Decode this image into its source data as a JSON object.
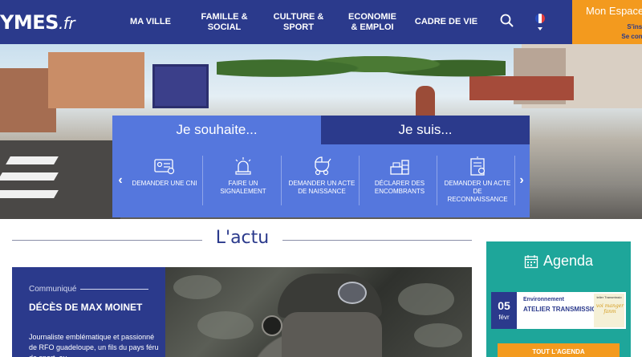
{
  "header": {
    "logo_main": "YMES",
    "logo_suffix": ".fr",
    "nav": [
      {
        "label": "MA VILLE"
      },
      {
        "label": "FAMILLE & SOCIAL"
      },
      {
        "label": "CULTURE & SPORT"
      },
      {
        "label": "ECONOMIE & EMPLOI"
      },
      {
        "label": "CADRE DE VIE"
      }
    ],
    "account_title": "Mon Espace",
    "account_signup": "S'inscri",
    "account_login": "Se conne"
  },
  "panel": {
    "tab_wish": "Je souhaite...",
    "tab_iam": "Je suis...",
    "prev": "‹",
    "next": "›",
    "services": [
      {
        "label": "DEMANDER UNE CNI",
        "icon": "id-card-icon"
      },
      {
        "label": "FAIRE UN SIGNALEMENT",
        "icon": "alert-light-icon"
      },
      {
        "label": "DEMANDER UN ACTE DE NAISSANCE",
        "icon": "baby-carriage-icon"
      },
      {
        "label": "DÉCLARER DES ENCOMBRANTS",
        "icon": "furniture-icon"
      },
      {
        "label": "DEMANDER UN ACTE DE RECONNAISSANCE",
        "icon": "certificate-icon"
      }
    ]
  },
  "actu": {
    "title": "L'actu",
    "category": "Communiqué",
    "headline": "DÉCÈS DE MAX MOINET",
    "excerpt": "Journaliste emblématique et passionné de RFO guadeloupe, un fils du pays féru de sport, au"
  },
  "agenda": {
    "title": "Agenda",
    "event": {
      "day": "05",
      "month": "févr",
      "category": "Environnement",
      "title": "ATELIER TRANSMISSION",
      "thumb_caption": "telier Transmissio",
      "thumb_script": "voi manger fanm"
    },
    "button": "TOUT L'AGENDA"
  },
  "colors": {
    "primary": "#2b3a8c",
    "panel": "#5577dd",
    "accent": "#f39a1e",
    "agenda": "#1ea69a"
  }
}
